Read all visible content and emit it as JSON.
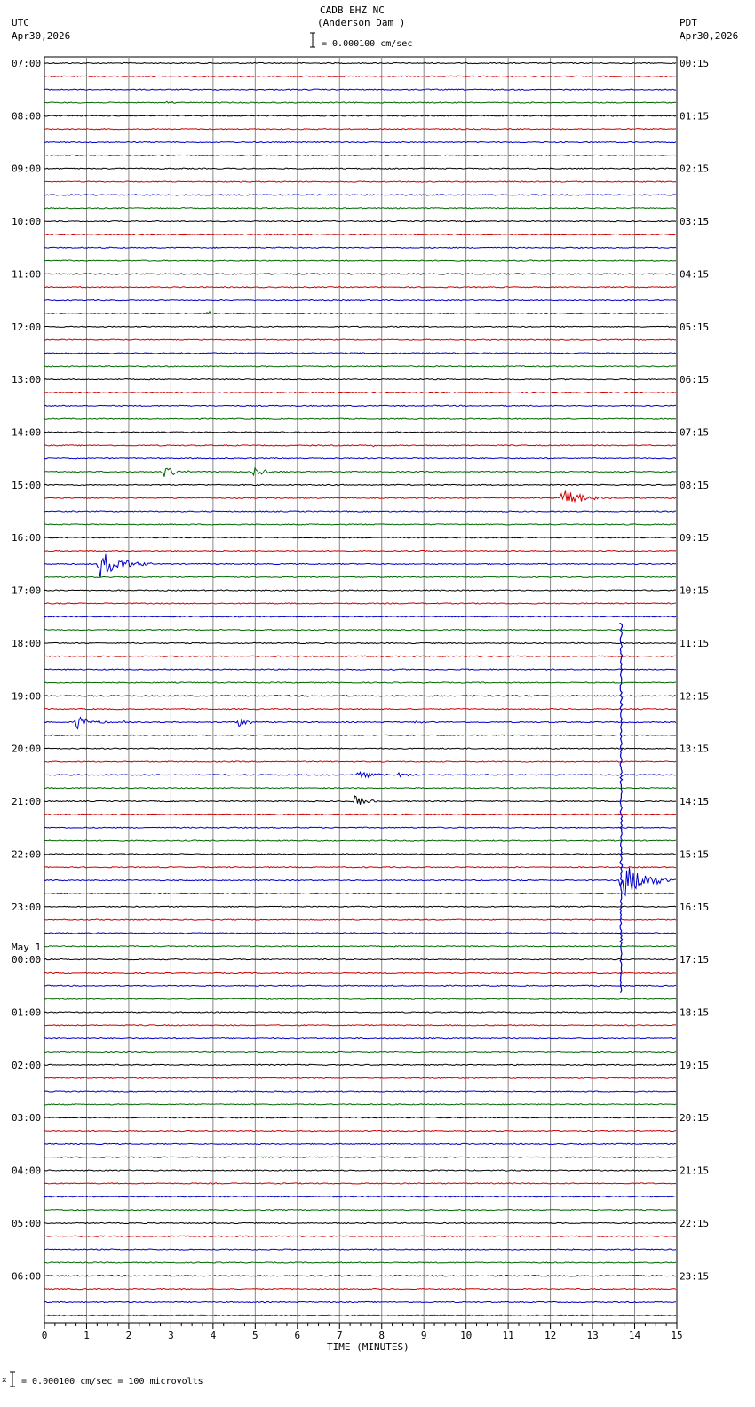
{
  "header": {
    "station": "CADB EHZ NC",
    "location": "(Anderson Dam )",
    "scale_text": "= 0.000100 cm/sec",
    "left_tz": "UTC",
    "left_date": "Apr30,2026",
    "right_tz": "PDT",
    "right_date": "Apr30,2026"
  },
  "footer": {
    "scale_text": "= 0.000100 cm/sec =     100 microvolts"
  },
  "colors": {
    "trace_cycle": [
      "#000000",
      "#cc0000",
      "#0000cc",
      "#006600"
    ],
    "grid": "#888888"
  },
  "chart_data": {
    "type": "line",
    "title": "CADB EHZ NC (Anderson Dam )",
    "xlabel": "TIME (MINUTES)",
    "xlim": [
      0,
      15
    ],
    "x_ticks": [
      "0",
      "1",
      "2",
      "3",
      "4",
      "5",
      "6",
      "7",
      "8",
      "9",
      "10",
      "11",
      "12",
      "13",
      "14",
      "15"
    ],
    "traces_per_hour": 4,
    "trace_count": 96,
    "utc_hour_labels": [
      {
        "trace": 0,
        "text": "07:00"
      },
      {
        "trace": 4,
        "text": "08:00"
      },
      {
        "trace": 8,
        "text": "09:00"
      },
      {
        "trace": 12,
        "text": "10:00"
      },
      {
        "trace": 16,
        "text": "11:00"
      },
      {
        "trace": 20,
        "text": "12:00"
      },
      {
        "trace": 24,
        "text": "13:00"
      },
      {
        "trace": 28,
        "text": "14:00"
      },
      {
        "trace": 32,
        "text": "15:00"
      },
      {
        "trace": 36,
        "text": "16:00"
      },
      {
        "trace": 40,
        "text": "17:00"
      },
      {
        "trace": 44,
        "text": "18:00"
      },
      {
        "trace": 48,
        "text": "19:00"
      },
      {
        "trace": 52,
        "text": "20:00"
      },
      {
        "trace": 56,
        "text": "21:00"
      },
      {
        "trace": 60,
        "text": "22:00"
      },
      {
        "trace": 64,
        "text": "23:00"
      },
      {
        "trace": 68,
        "text": "00:00",
        "pre": "May 1"
      },
      {
        "trace": 72,
        "text": "01:00"
      },
      {
        "trace": 76,
        "text": "02:00"
      },
      {
        "trace": 80,
        "text": "03:00"
      },
      {
        "trace": 84,
        "text": "04:00"
      },
      {
        "trace": 88,
        "text": "05:00"
      },
      {
        "trace": 92,
        "text": "06:00"
      }
    ],
    "pdt_hour_labels": [
      {
        "trace": 0,
        "text": "00:15"
      },
      {
        "trace": 4,
        "text": "01:15"
      },
      {
        "trace": 8,
        "text": "02:15"
      },
      {
        "trace": 12,
        "text": "03:15"
      },
      {
        "trace": 16,
        "text": "04:15"
      },
      {
        "trace": 20,
        "text": "05:15"
      },
      {
        "trace": 24,
        "text": "06:15"
      },
      {
        "trace": 28,
        "text": "07:15"
      },
      {
        "trace": 32,
        "text": "08:15"
      },
      {
        "trace": 36,
        "text": "09:15"
      },
      {
        "trace": 40,
        "text": "10:15"
      },
      {
        "trace": 44,
        "text": "11:15"
      },
      {
        "trace": 48,
        "text": "12:15"
      },
      {
        "trace": 52,
        "text": "13:15"
      },
      {
        "trace": 56,
        "text": "14:15"
      },
      {
        "trace": 60,
        "text": "15:15"
      },
      {
        "trace": 64,
        "text": "16:15"
      },
      {
        "trace": 68,
        "text": "17:15"
      },
      {
        "trace": 72,
        "text": "18:15"
      },
      {
        "trace": 76,
        "text": "19:15"
      },
      {
        "trace": 80,
        "text": "20:15"
      },
      {
        "trace": 84,
        "text": "21:15"
      },
      {
        "trace": 88,
        "text": "22:15"
      },
      {
        "trace": 92,
        "text": "23:15"
      }
    ],
    "events": [
      {
        "trace": 3,
        "minute": 2.9,
        "amp": 0.15,
        "dur": 0.5
      },
      {
        "trace": 19,
        "minute": 3.9,
        "amp": 0.6,
        "dur": 0.1
      },
      {
        "trace": 29,
        "minute": 7.8,
        "amp": 0.2,
        "dur": 0.3
      },
      {
        "trace": 31,
        "minute": 2.8,
        "amp": 1.0,
        "dur": 0.9
      },
      {
        "trace": 31,
        "minute": 4.95,
        "amp": 0.9,
        "dur": 0.9
      },
      {
        "trace": 33,
        "minute": 12.2,
        "amp": 2.0,
        "dur": 1.3
      },
      {
        "trace": 38,
        "minute": 1.3,
        "amp": 2.5,
        "dur": 1.3
      },
      {
        "trace": 50,
        "minute": 0.75,
        "amp": 1.2,
        "dur": 0.9
      },
      {
        "trace": 50,
        "minute": 1.85,
        "amp": 0.3,
        "dur": 0.5
      },
      {
        "trace": 50,
        "minute": 4.6,
        "amp": 0.8,
        "dur": 0.6
      },
      {
        "trace": 50,
        "minute": 8.8,
        "amp": 0.2,
        "dur": 0.6
      },
      {
        "trace": 54,
        "minute": 7.4,
        "amp": 0.9,
        "dur": 0.9
      },
      {
        "trace": 54,
        "minute": 8.4,
        "amp": 0.5,
        "dur": 0.6
      },
      {
        "trace": 56,
        "minute": 7.35,
        "amp": 1.0,
        "dur": 0.8
      },
      {
        "trace": 62,
        "minute": 13.7,
        "amp": 3.0,
        "dur": 1.6
      }
    ],
    "large_event": {
      "trace": 62,
      "minute": 13.68,
      "top_trace": 42.5,
      "bottom_trace": 70.6
    }
  }
}
